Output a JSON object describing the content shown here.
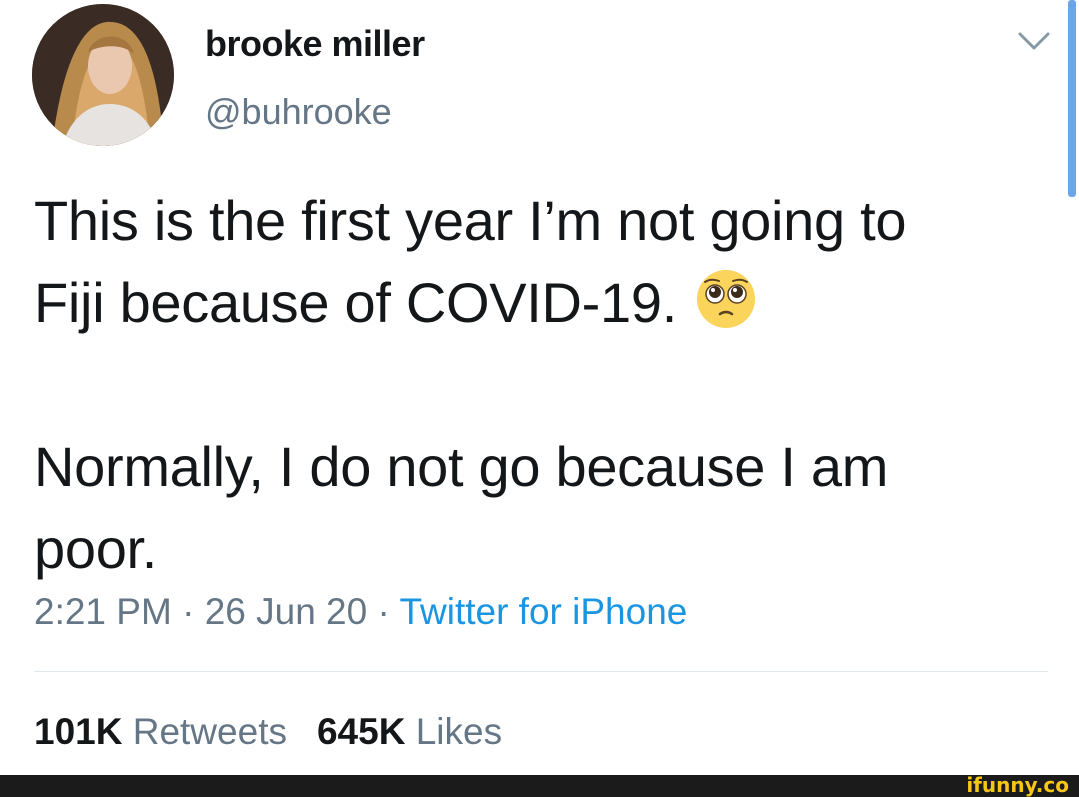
{
  "author": {
    "display_name": "brooke miller",
    "handle": "@buhrooke"
  },
  "tweet": {
    "line_1": "This is the first year I’m not going to",
    "line_2": "Fiji because of COVID-19.",
    "emoji": "pleading-face-icon",
    "line_3": "Normally, I do not go because I am",
    "line_4": "poor."
  },
  "meta": {
    "time": "2:21 PM",
    "separator_1": " · ",
    "date": "26 Jun 20",
    "separator_2": " · ",
    "source": "Twitter for iPhone"
  },
  "stats": {
    "retweets_count": "101K",
    "retweets_label": "Retweets",
    "likes_count": "645K",
    "likes_label": "Likes"
  },
  "watermark": "ifunny.co",
  "colors": {
    "text_primary": "#14171a",
    "text_secondary": "#657786",
    "link_blue": "#1b95e0",
    "divider": "#e1e8ed",
    "scrollbar": "#6aa6e8"
  }
}
